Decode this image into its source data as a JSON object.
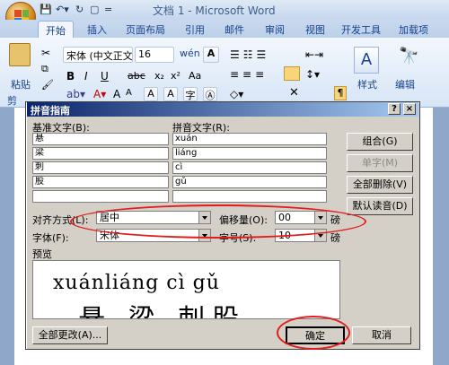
{
  "window": {
    "title": "文档 1 - Microsoft Word"
  },
  "ribbon": {
    "tabs": [
      "开始",
      "插入",
      "页面布局",
      "引用",
      "邮件",
      "审阅",
      "视图",
      "开发工具",
      "加载项"
    ],
    "font_name": "宋体 (中文正文",
    "font_size": "16",
    "paste_label": "粘贴",
    "clipboard_label": "剪",
    "style_label": "样式",
    "edit_label": "编辑"
  },
  "dialog": {
    "title": "拼音指南",
    "base_header": "基准文字(B):",
    "pinyin_header": "拼音文字(R):",
    "rows": [
      {
        "base": "悬",
        "pinyin": "xuán"
      },
      {
        "base": "梁",
        "pinyin": "liáng"
      },
      {
        "base": "刺",
        "pinyin": "cì"
      },
      {
        "base": "股",
        "pinyin": "gǔ"
      },
      {
        "base": "",
        "pinyin": ""
      }
    ],
    "buttons": {
      "group": "组合(G)",
      "single": "单字(M)",
      "clear_all": "全部删除(V)",
      "default_reading": "默认读音(D)",
      "change_all": "全部更改(A)...",
      "ok": "确定",
      "cancel": "取消"
    },
    "alignment_label": "对齐方式(L):",
    "alignment_value": "居中",
    "offset_label": "偏移量(O):",
    "offset_value": "00",
    "offset_unit": "磅",
    "font_label": "字体(F):",
    "font_value": "宋体",
    "size_label": "字号(S):",
    "size_value": "10",
    "size_unit": "磅",
    "preview_label": "预览",
    "preview_pinyin": "xuánliáng cì gǔ",
    "preview_base": "悬 梁 刺股",
    "help": "?",
    "close": "×"
  },
  "colors": {
    "annotation": "#e21c1c",
    "title_bar": "#0a246a"
  }
}
